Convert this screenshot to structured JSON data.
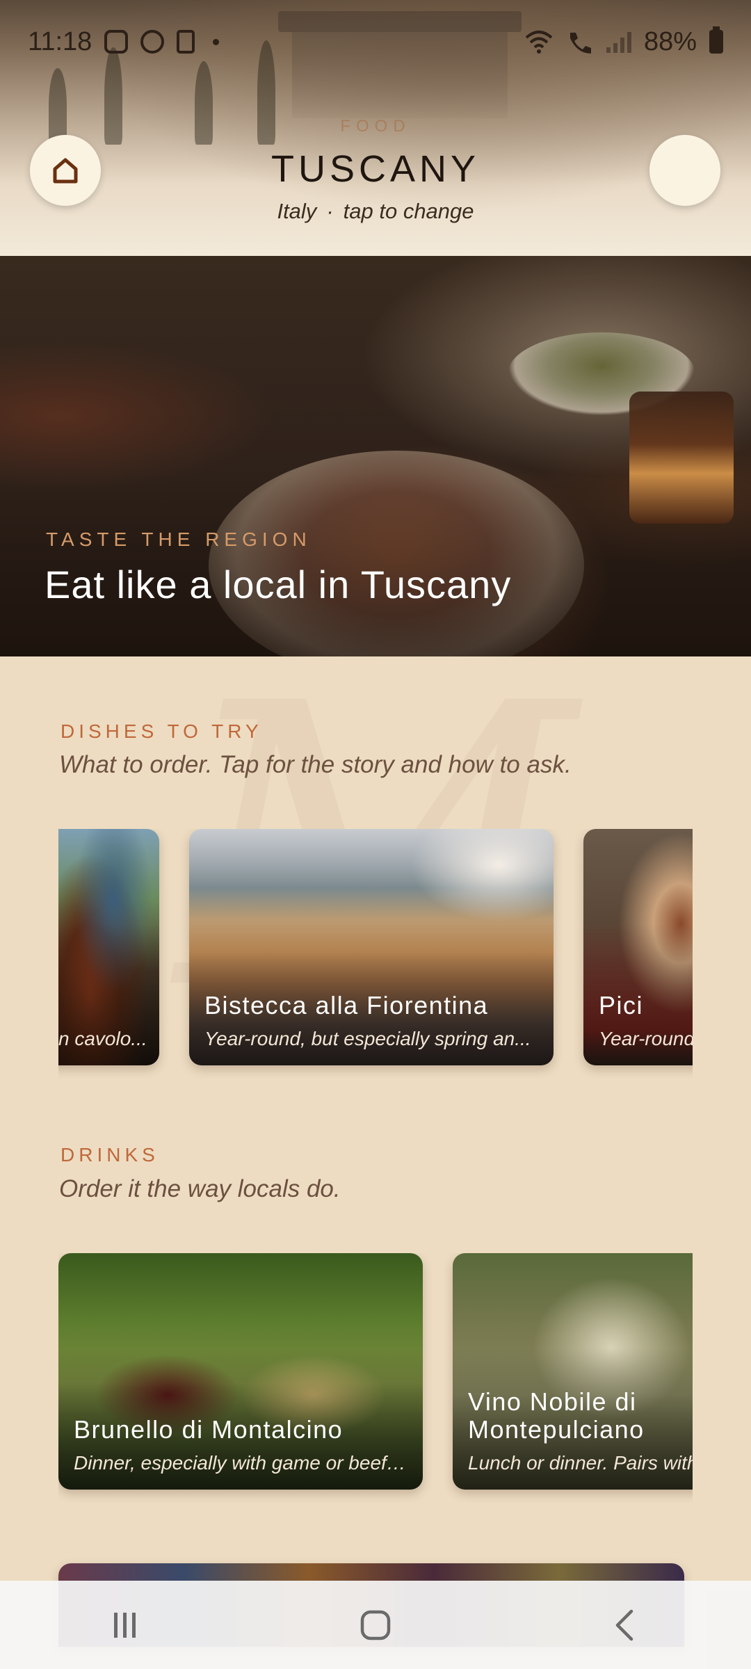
{
  "status_bar": {
    "time": "11:18",
    "battery": "88%"
  },
  "header": {
    "category_label": "FOOD",
    "region": "TUSCANY",
    "country": "Italy",
    "separator": "·",
    "change_hint": "tap to change"
  },
  "hero": {
    "kicker": "TASTE THE REGION",
    "title": "Eat like a local in Tuscany"
  },
  "dishes": {
    "kicker": "DISHES TO TRY",
    "subtitle": "What to order. Tap for the story and how to ask.",
    "cards": [
      {
        "title": "",
        "meta": "n cavolo..."
      },
      {
        "title": "Bistecca alla Fiorentina",
        "meta": "Year-round, but especially spring an..."
      },
      {
        "title": "Pici",
        "meta": "Year-round"
      }
    ]
  },
  "drinks": {
    "kicker": "DRINKS",
    "subtitle": "Order it the way locals do.",
    "cards": [
      {
        "title": "Brunello di Montalcino",
        "meta": "Dinner, especially with game or beef...."
      },
      {
        "title_line1": "Vino Nobile di",
        "title_line2": "Montepulciano",
        "meta": "Lunch or dinner. Pairs with"
      }
    ]
  },
  "icons": {
    "home": "home-icon",
    "nav_recent": "recent-apps-icon",
    "nav_home": "nav-home-icon",
    "nav_back": "back-icon"
  },
  "colors": {
    "background": "#eddcc2",
    "accent": "#c0683a",
    "hero_kicker": "#d69b6a",
    "button_bg": "#fbf3e2"
  }
}
